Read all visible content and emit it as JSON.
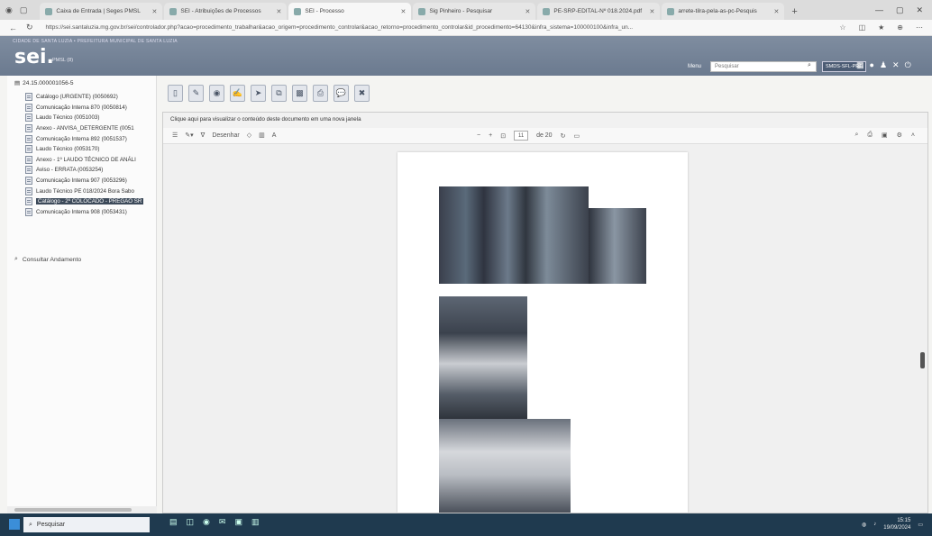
{
  "browser": {
    "tabs": [
      {
        "label": "Caixa de Entrada | Seges PMSL",
        "active": false
      },
      {
        "label": "SEI - Atribuições de Processos",
        "active": false
      },
      {
        "label": "SEI - Processo",
        "active": true
      },
      {
        "label": "Sig Pinheiro - Pesquisar",
        "active": false
      },
      {
        "label": "PE-SRP-EDITAL-Nº 018.2024.pdf",
        "active": false
      },
      {
        "label": "arrete-tilra-pela-as-pc-Pesquis",
        "active": false
      }
    ],
    "url": "https://sei.santaluzia.mg.gov.br/sei/controlador.php?acao=procedimento_trabalhar&acao_origem=procedimento_controlar&acao_retorno=procedimento_controlar&id_procedimento=64130&infra_sistema=100000100&infra_un..."
  },
  "sei": {
    "org_line": "CIDADE DE SANTA LUZIA • PREFEITURA MUNICIPAL DE SANTA LUZIA",
    "logo": "sei.",
    "logo_sub": "PMSL (8)",
    "menu_label": "Menu",
    "search_placeholder": "Pesquisar",
    "unit": "SMDS-SFL-PRE"
  },
  "tree": {
    "process_number": "24.15.000001056-5",
    "documents": [
      {
        "label": "Catálogo (URGENTE) (0050692)",
        "selected": false
      },
      {
        "label": "Comunicação Interna 870 (0050814)",
        "selected": false
      },
      {
        "label": "Laudo Técnico (0051003)",
        "selected": false
      },
      {
        "label": "Anexo - ANVISA_DETERGENTE (0051",
        "selected": false
      },
      {
        "label": "Comunicação Interna 892 (0051537)",
        "selected": false
      },
      {
        "label": "Laudo Técnico (0053170)",
        "selected": false
      },
      {
        "label": "Anexo - 1º LAUDO TÉCNICO DE ANÁLI",
        "selected": false
      },
      {
        "label": "Aviso - ERRATA (0053254)",
        "selected": false
      },
      {
        "label": "Comunicação Interna 907 (0053296)",
        "selected": false
      },
      {
        "label": "Laudo Técnico PE 018/2024 Bora Sabo",
        "selected": false
      },
      {
        "label": "Catálogo - 2º COLOCADO - PREGÃO SR",
        "selected": true
      },
      {
        "label": "Comunicação Interna 908 (0053431)",
        "selected": false
      }
    ],
    "consultar": "Consultar Andamento"
  },
  "viewer": {
    "hint": "Clique aqui para visualizar o conteúdo deste documento em uma nova janela",
    "draw_label": "Desenhar",
    "page_current": "11",
    "page_total": "de 20"
  },
  "taskbar": {
    "search": "Pesquisar",
    "time": "15:15",
    "date": "19/09/2024"
  }
}
